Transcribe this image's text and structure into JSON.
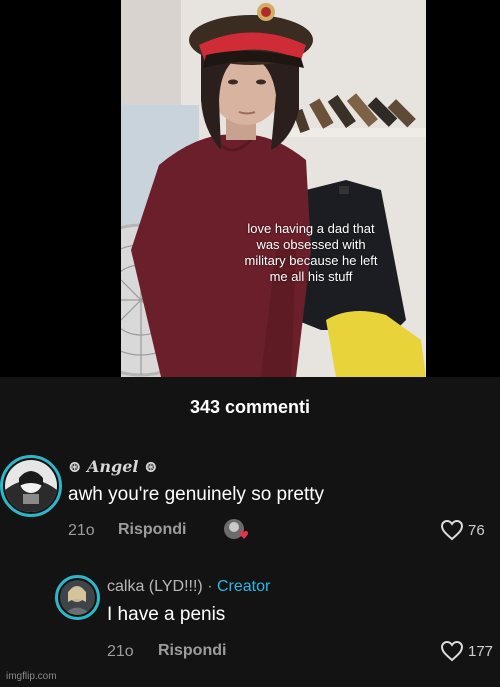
{
  "video": {
    "caption_lines": [
      "love having a dad that",
      "was obsessed with",
      "military because he left",
      "me all his stuff"
    ]
  },
  "comments_header": {
    "count_label": "343 commenti"
  },
  "comments": [
    {
      "username": "Angel",
      "username_symbol": "⊛",
      "text": "awh you're genuinely so pretty",
      "time": "21o",
      "reply_label": "Rispondi",
      "likes": "76"
    }
  ],
  "replies": [
    {
      "username": "calka (LYD!!!)",
      "separator": "·",
      "badge": "Creator",
      "text": "I have a penis",
      "time": "21o",
      "reply_label": "Rispondi",
      "likes": "177"
    }
  ],
  "watermark": "imgflip.com",
  "colors": {
    "accent_ring": "#2fb5c7",
    "creator_badge": "#2ab7e8",
    "creator_like_heart": "#e8304f"
  }
}
